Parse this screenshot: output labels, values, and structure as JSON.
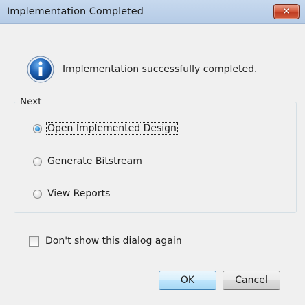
{
  "window": {
    "title": "Implementation Completed",
    "close_glyph": "✕"
  },
  "message": {
    "icon": "info-icon",
    "text": "Implementation successfully completed."
  },
  "next_group": {
    "label": "Next",
    "options": [
      {
        "label": "Open Implemented Design",
        "selected": true
      },
      {
        "label": "Generate Bitstream",
        "selected": false
      },
      {
        "label": "View Reports",
        "selected": false
      }
    ]
  },
  "dont_show": {
    "label": "Don't show this dialog again",
    "checked": false
  },
  "buttons": {
    "ok_label": "OK",
    "cancel_label": "Cancel"
  },
  "colors": {
    "titlebar": "#b9cde8",
    "close_button": "#c9452a",
    "dialog_background": "#f0f0f0",
    "info_icon": "#1f5fae"
  }
}
